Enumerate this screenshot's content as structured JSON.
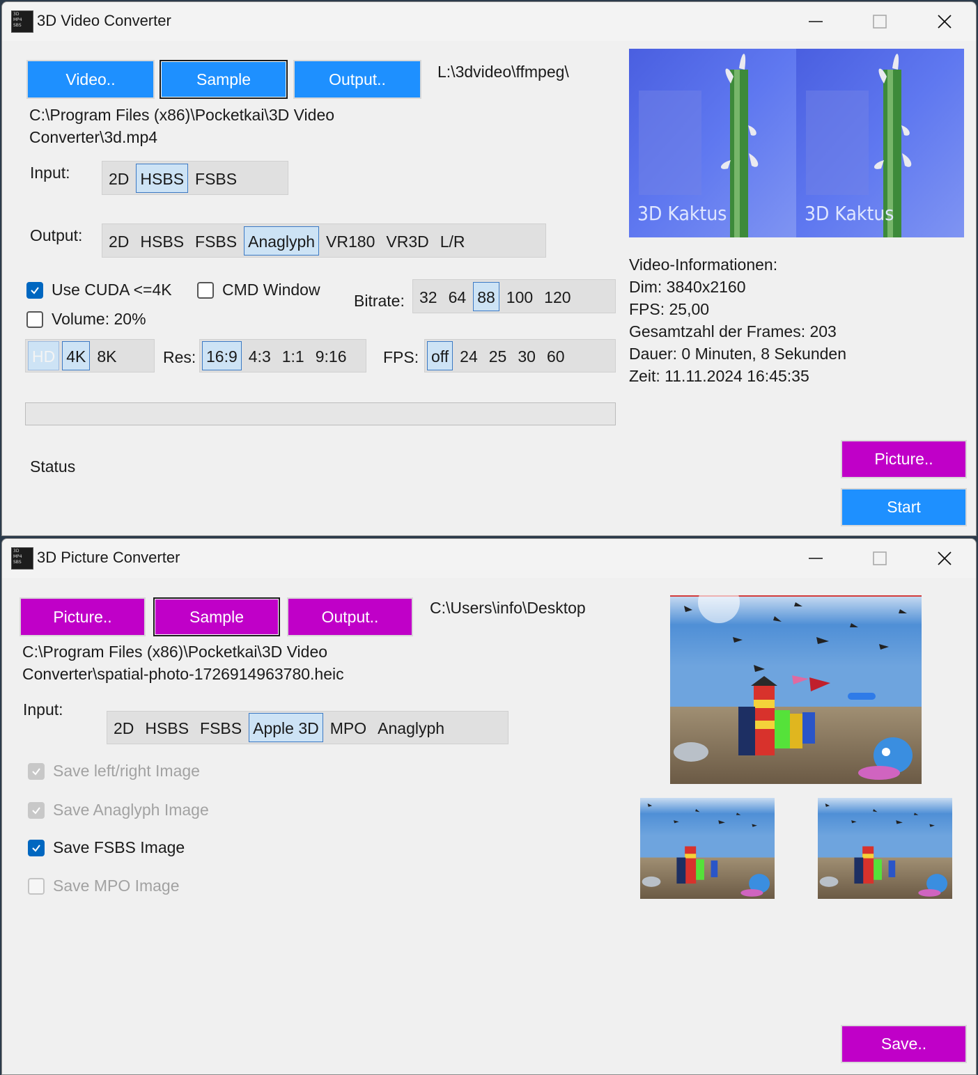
{
  "video_window": {
    "title": "3D Video Converter",
    "icon_lines": [
      "3D",
      "MP4",
      "SBS"
    ],
    "buttons": {
      "video": "Video..",
      "sample": "Sample",
      "output": "Output..",
      "picture": "Picture..",
      "start": "Start"
    },
    "output_path": "L:\\3dvideo\\ffmpeg\\",
    "input_file_line1": "C:\\Program Files (x86)\\Pocketkai\\3D Video",
    "input_file_line2": "Converter\\3d.mp4",
    "input_label": "Input:",
    "input_options": [
      "2D",
      "HSBS",
      "FSBS"
    ],
    "input_selected": "HSBS",
    "output_label": "Output:",
    "output_options": [
      "2D",
      "HSBS",
      "FSBS",
      "Anaglyph",
      "VR180",
      "VR3D",
      "L/R"
    ],
    "output_selected": "Anaglyph",
    "use_cuda": {
      "label": "Use CUDA <=4K",
      "checked": true
    },
    "cmd_window": {
      "label": "CMD Window",
      "checked": false
    },
    "volume": {
      "label": "Volume: 20%",
      "checked": false
    },
    "bitrate_label": "Bitrate:",
    "bitrate_options": [
      "32",
      "64",
      "88",
      "100",
      "120"
    ],
    "bitrate_selected": "88",
    "quality_options": [
      "HD",
      "4K",
      "8K"
    ],
    "quality_selected": "4K",
    "res_label": "Res:",
    "res_options": [
      "16:9",
      "4:3",
      "1:1",
      "9:16"
    ],
    "res_selected": "16:9",
    "fps_label": "FPS:",
    "fps_options": [
      "off",
      "24",
      "25",
      "30",
      "60"
    ],
    "fps_selected": "off",
    "progress": 0,
    "status": "Status",
    "preview_caption": "3D Kaktus",
    "info": {
      "heading": "Video-Informationen:",
      "dim": "Dim: 3840x2160",
      "fps": "FPS: 25,00",
      "frames": "Gesamtzahl der Frames: 203",
      "duration": "Dauer: 0 Minuten, 8 Sekunden",
      "time": "Zeit: 11.11.2024 16:45:35"
    }
  },
  "picture_window": {
    "title": "3D Picture Converter",
    "icon_lines": [
      "3D",
      "MP4",
      "SBS"
    ],
    "buttons": {
      "picture": "Picture..",
      "sample": "Sample",
      "output": "Output..",
      "save": "Save.."
    },
    "output_path": "C:\\Users\\info\\Desktop",
    "input_file_line1": "C:\\Program Files (x86)\\Pocketkai\\3D Video",
    "input_file_line2": "Converter\\spatial-photo-1726914963780.heic",
    "input_label": "Input:",
    "input_options": [
      "2D",
      "HSBS",
      "FSBS",
      "Apple 3D",
      "MPO",
      "Anaglyph"
    ],
    "input_selected": "Apple 3D",
    "checks": [
      {
        "label": "Save left/right Image",
        "state": "disabled-checked"
      },
      {
        "label": "Save Anaglyph Image",
        "state": "disabled-checked"
      },
      {
        "label": "Save FSBS Image",
        "state": "checked"
      },
      {
        "label": "Save MPO Image",
        "state": "disabled"
      }
    ]
  },
  "colors": {
    "blue_button": "#1e90ff",
    "purple_button": "#c000c8",
    "selection": "#cde3f5",
    "checkbox_accent": "#0067c0"
  }
}
